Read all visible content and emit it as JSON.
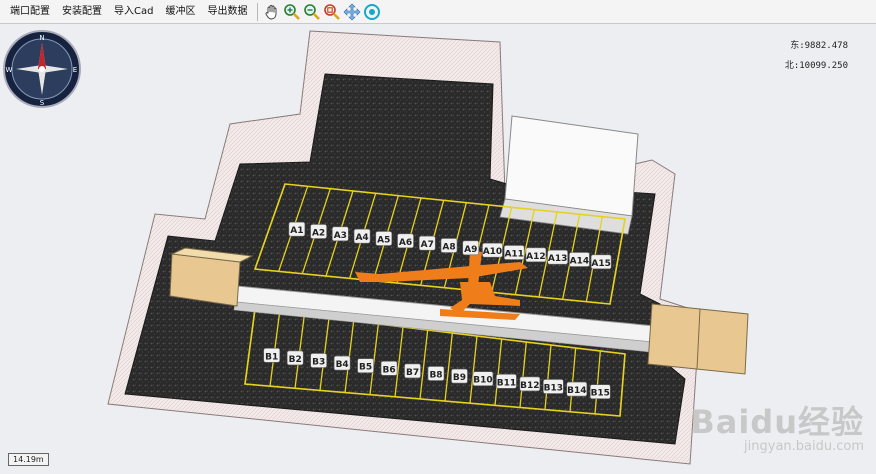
{
  "toolbar": {
    "menu": [
      "端口配置",
      "安装配置",
      "导入Cad",
      "缓冲区",
      "导出数据"
    ],
    "tools": [
      "pan-hand-icon",
      "zoom-in-icon",
      "zoom-out-icon",
      "zoom-fit-icon",
      "move-icon",
      "rotate-icon"
    ]
  },
  "coords": {
    "east": "东:9882.478",
    "north": "北:10099.250"
  },
  "compass": {
    "n": "N",
    "s": "S",
    "e": "E",
    "w": "W"
  },
  "scale_label": "14.19m",
  "watermark": {
    "main": "Baidu经验",
    "sub": "jingyan.baidu.com"
  },
  "scene": {
    "bays_a": [
      "A1",
      "A2",
      "A3",
      "A4",
      "A5",
      "A6",
      "A7",
      "A8",
      "A9",
      "A10",
      "A11",
      "A12",
      "A13",
      "A14",
      "A15"
    ],
    "bays_b": [
      "B1",
      "B2",
      "B3",
      "B4",
      "B5",
      "B6",
      "B7",
      "B8",
      "B9",
      "B10",
      "B11",
      "B12",
      "B13",
      "B14",
      "B15"
    ],
    "colors": {
      "floor": "#262626",
      "crane": "#ef7d1a",
      "bay_line": "#e6d21c",
      "wall": "#f1e4e4",
      "box": "#e8c890"
    }
  }
}
